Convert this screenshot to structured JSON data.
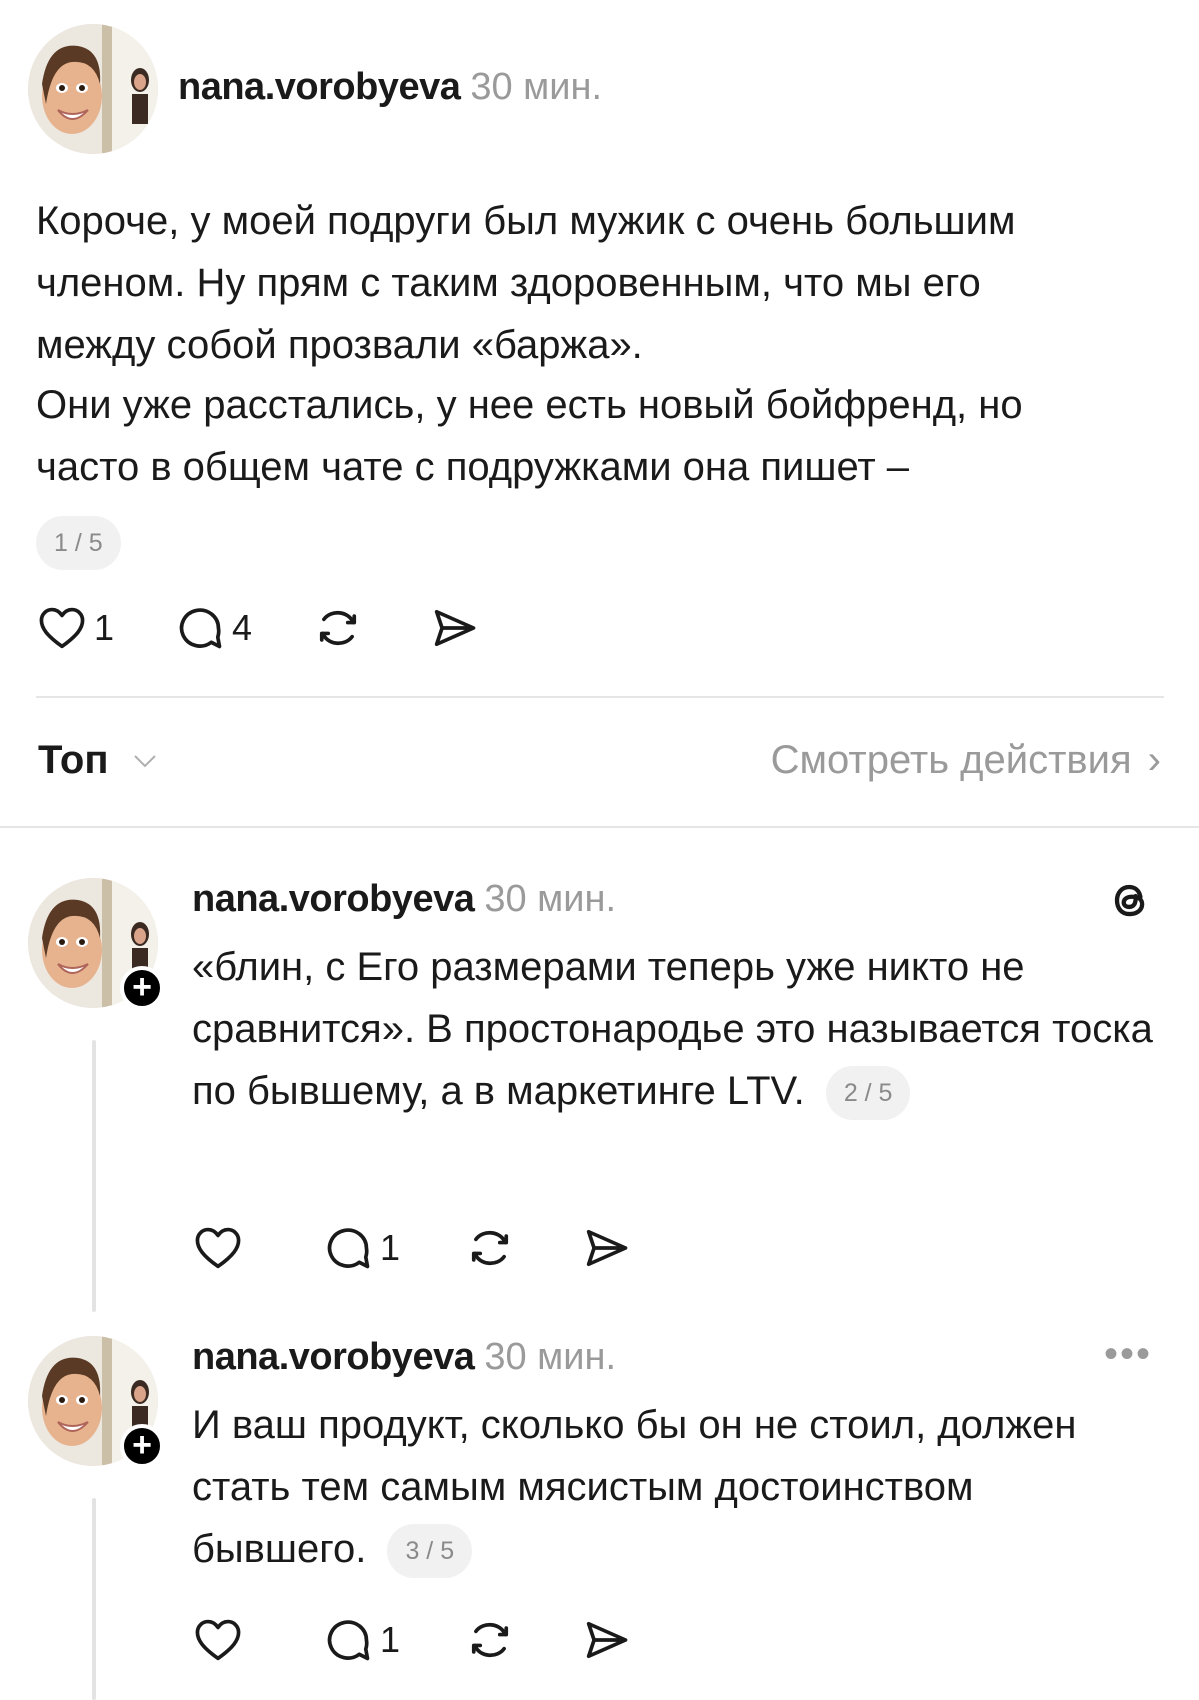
{
  "post": {
    "username": "nana.vorobyeva",
    "time": "30 мин.",
    "paragraphs": [
      "Короче, у моей подруги был мужик с очень большим членом. Ну прям с таким здоровенным, что мы его между собой прозвали «баржа».",
      "Они уже расстались, у нее есть новый бойфренд, но часто в общем чате с подружками она пишет –"
    ],
    "counter": "1 / 5",
    "likes": "1",
    "comments": "4"
  },
  "sort": {
    "label": "Топ",
    "activity_link": "Смотреть действия"
  },
  "replies": [
    {
      "username": "nana.vorobyeva",
      "time": "30 мин.",
      "text": "«блин, с Его размерами теперь уже никто не сравнится». В простонародье это называется тоска по бывшему, а в маркетинге LTV.",
      "counter": "2 / 5",
      "likes": "",
      "comments": "1",
      "corner_icon": "threads-icon"
    },
    {
      "username": "nana.vorobyeva",
      "time": "30 мин.",
      "text": "И ваш продукт, сколько бы он не стоил, должен стать тем самым мясистым достоинством бывшего.",
      "counter": "3 / 5",
      "likes": "",
      "comments": "1",
      "corner_icon": "more-icon"
    }
  ],
  "colors": {
    "text": "#1a1a1a",
    "muted": "#9a9a9a",
    "divider": "#e6e6e6",
    "badge_bg": "#f1f1f1"
  }
}
